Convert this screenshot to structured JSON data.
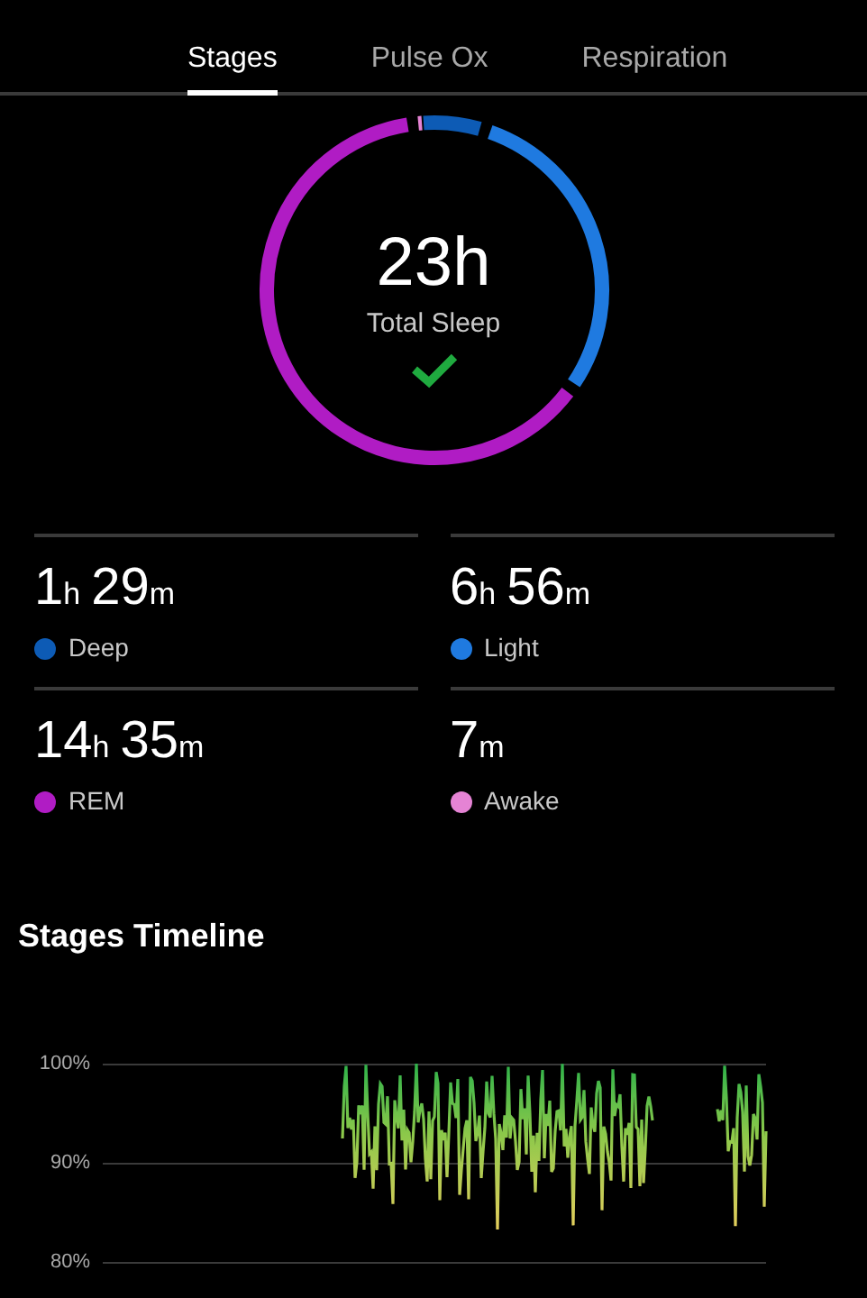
{
  "tabs": [
    {
      "label": "Stages",
      "selected": true
    },
    {
      "label": "Pulse Ox",
      "selected": false
    },
    {
      "label": "Respiration",
      "selected": false
    }
  ],
  "summary": {
    "value": "23h",
    "label": "Total Sleep",
    "goal_met": true
  },
  "stages": [
    {
      "parts": [
        {
          "num": "1",
          "unit": "h"
        },
        {
          "num": "29",
          "unit": "m"
        }
      ],
      "name": "Deep",
      "color": "#0d5bb5"
    },
    {
      "parts": [
        {
          "num": "6",
          "unit": "h"
        },
        {
          "num": "56",
          "unit": "m"
        }
      ],
      "name": "Light",
      "color": "#1f7ae0"
    },
    {
      "parts": [
        {
          "num": "14",
          "unit": "h"
        },
        {
          "num": "35",
          "unit": "m"
        }
      ],
      "name": "REM",
      "color": "#b01cc4"
    },
    {
      "parts": [
        {
          "num": "7",
          "unit": "m"
        }
      ],
      "name": "Awake",
      "color": "#e583d4"
    }
  ],
  "timeline": {
    "title": "Stages Timeline",
    "y_labels": [
      "100%",
      "90%",
      "80%"
    ]
  }
}
